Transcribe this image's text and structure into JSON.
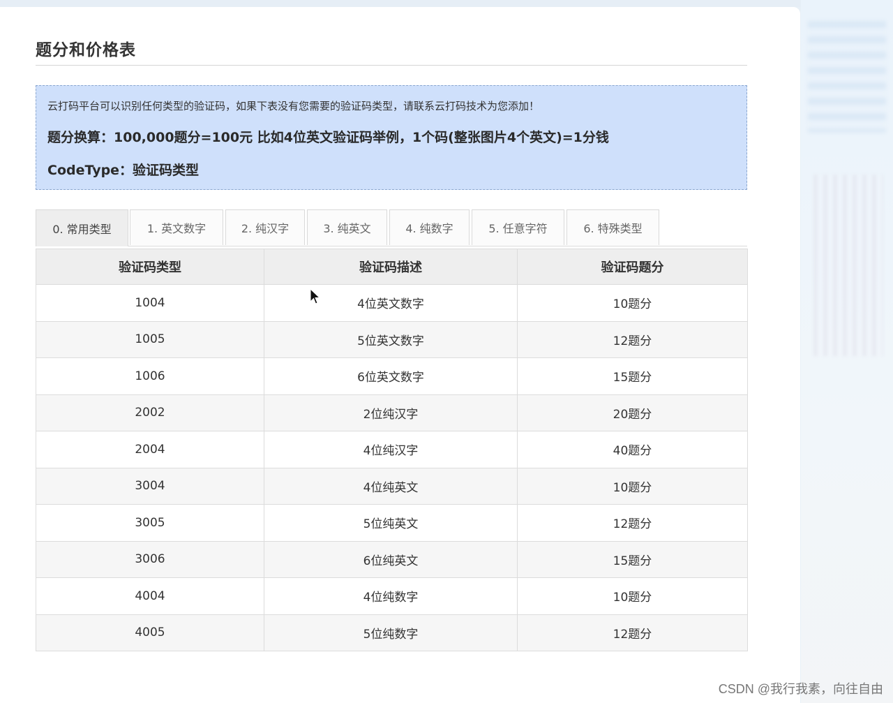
{
  "page": {
    "title": "题分和价格表"
  },
  "notice": {
    "line1": "云打码平台可以识别任何类型的验证码，如果下表没有您需要的验证码类型，请联系云打码技术为您添加！",
    "line2": "题分换算：100,000题分=100元 比如4位英文验证码举例，1个码(整张图片4个英文)=1分钱",
    "line3": "CodeType：验证码类型"
  },
  "tabs": [
    {
      "label": "0. 常用类型",
      "active": true
    },
    {
      "label": "1. 英文数字",
      "active": false
    },
    {
      "label": "2. 纯汉字",
      "active": false
    },
    {
      "label": "3. 纯英文",
      "active": false
    },
    {
      "label": "4. 纯数字",
      "active": false
    },
    {
      "label": "5. 任意字符",
      "active": false
    },
    {
      "label": "6. 特殊类型",
      "active": false
    }
  ],
  "table": {
    "headers": [
      "验证码类型",
      "验证码描述",
      "验证码题分"
    ],
    "rows": [
      [
        "1004",
        "4位英文数字",
        "10题分"
      ],
      [
        "1005",
        "5位英文数字",
        "12题分"
      ],
      [
        "1006",
        "6位英文数字",
        "15题分"
      ],
      [
        "2002",
        "2位纯汉字",
        "20题分"
      ],
      [
        "2004",
        "4位纯汉字",
        "40题分"
      ],
      [
        "3004",
        "4位纯英文",
        "10题分"
      ],
      [
        "3005",
        "5位纯英文",
        "12题分"
      ],
      [
        "3006",
        "6位纯英文",
        "15题分"
      ],
      [
        "4004",
        "4位纯数字",
        "10题分"
      ],
      [
        "4005",
        "5位纯数字",
        "12题分"
      ]
    ]
  },
  "watermark": "CSDN @我行我素，向往自由",
  "icons": {
    "cursor": "mouse-pointer-icon"
  }
}
